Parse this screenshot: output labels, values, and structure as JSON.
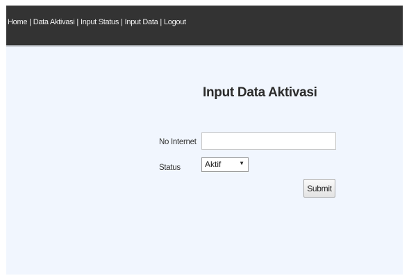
{
  "nav": {
    "items": [
      {
        "label": "Home"
      },
      {
        "label": "Data Aktivasi"
      },
      {
        "label": "Input Status"
      },
      {
        "label": "Input Data"
      },
      {
        "label": "Logout"
      }
    ],
    "separator": "|"
  },
  "main": {
    "title": "Input Data Aktivasi"
  },
  "form": {
    "no_internet": {
      "label": "No Internet",
      "value": ""
    },
    "status": {
      "label": "Status",
      "selected": "Aktif"
    },
    "submit_label": "Submit"
  },
  "colors": {
    "header_bg": "#333333",
    "page_bg": "#f1f6fe"
  }
}
